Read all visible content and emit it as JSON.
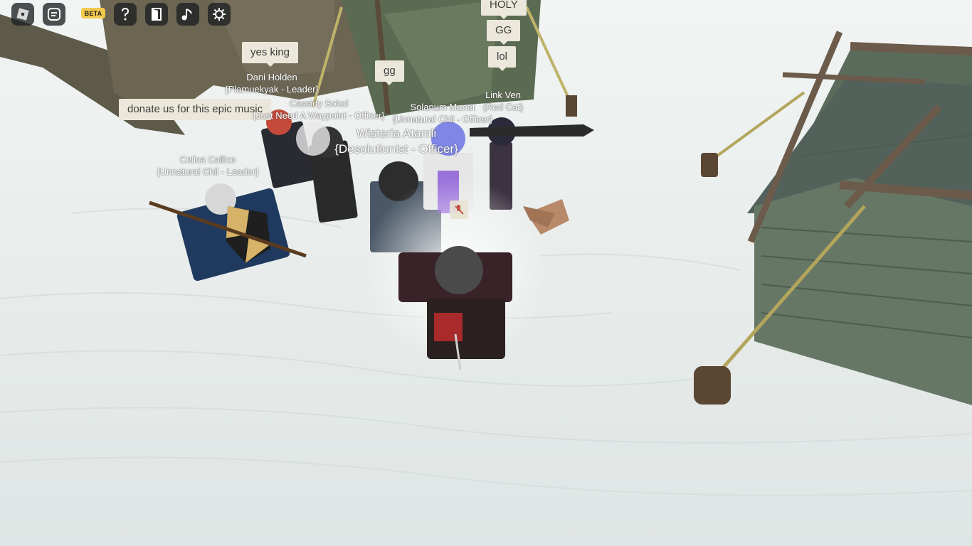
{
  "toolbar": {
    "roblox_icon": "roblox-logo-icon",
    "chat_icon": "chat-icon",
    "beta_label": "BETA",
    "help_icon": "help-icon",
    "door_icon": "door-icon",
    "music_icon": "music-icon",
    "settings_icon": "gear-icon"
  },
  "bubbles": {
    "holy": "HOLY",
    "gg_caps": "GG",
    "lol": "lol",
    "yes_king": "yes king",
    "gg": "gg",
    "donate": "donate us for this epic music"
  },
  "nametags": {
    "dani": {
      "name": "Dani Holden",
      "group": "{Plamuekyak - Leader}"
    },
    "cassidy": {
      "name": "Cassidy Sokol",
      "group": "{Just Need A Waypoint - Officer}"
    },
    "solanum": {
      "name": "Solanum Munet",
      "group": "{Unnatural Chil - Officer}"
    },
    "link": {
      "name": "Link Ven",
      "group": "{Red Cat}"
    },
    "wisteria": {
      "name": "Wisteria Atamli",
      "group": "{Desolutionist - Officer}"
    },
    "celica": {
      "name": "Celica Callico",
      "group": "{Unnatural Chil - Leader}"
    }
  },
  "colors": {
    "snow": "#e9eeed",
    "tent_green": "#5b6b52",
    "bubble_bg": "#ebe7db",
    "beta_badge": "#f2c94c"
  }
}
